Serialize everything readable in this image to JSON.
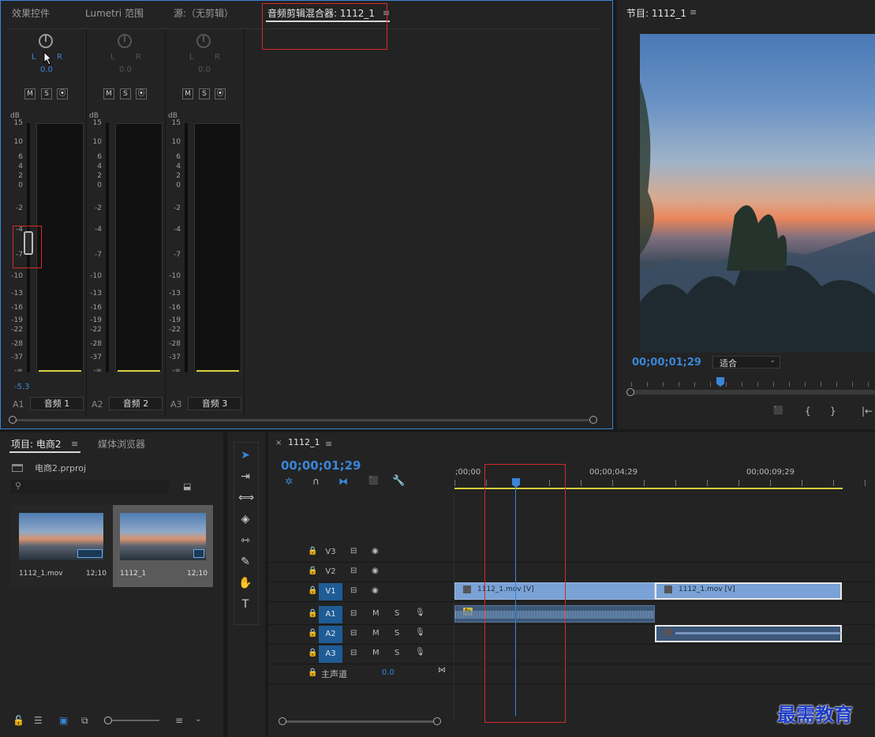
{
  "mixer_panel": {
    "tabs": [
      "效果控件",
      "Lumetri 范围",
      "源:（无剪辑）",
      "音频剪辑混合器: 1112_1"
    ],
    "active_tab_index": 3,
    "db_unit": "dB",
    "scale": [
      "15",
      "10",
      "6",
      "4",
      "2",
      "0",
      "-2",
      "-4",
      "-7",
      "-10",
      "-13",
      "-16",
      "-19",
      "-22",
      "-28",
      "-37",
      "-∞"
    ],
    "channels": [
      {
        "id": "A1",
        "name": "音频 1",
        "pan_l": "L",
        "pan_r": "R",
        "pan_value": "0.0",
        "level": "-5.3",
        "active": true
      },
      {
        "id": "A2",
        "name": "音频 2",
        "pan_l": "L",
        "pan_r": "R",
        "pan_value": "0.0",
        "level": "",
        "active": false
      },
      {
        "id": "A3",
        "name": "音频 3",
        "pan_l": "L",
        "pan_r": "R",
        "pan_value": "0.0",
        "level": "",
        "active": false
      }
    ],
    "msr": [
      "M",
      "S",
      "⦿"
    ]
  },
  "program_monitor": {
    "title": "节目: 1112_1",
    "timecode": "00;00;01;29",
    "fit_option": "适合",
    "controls": [
      "⬛",
      "{",
      "}",
      "|←"
    ]
  },
  "project_panel": {
    "tabs": [
      "项目: 电商2",
      "媒体浏览器"
    ],
    "project_file": "电商2.prproj",
    "items": [
      {
        "name": "1112_1.mov",
        "duration": "12;10"
      },
      {
        "name": "1112_1",
        "duration": "12;10"
      }
    ]
  },
  "timeline": {
    "sequence_tab": "1112_1",
    "timecode": "00;00;01;29",
    "ruler": [
      ";00;00",
      "00;00;04;29",
      "00;00;09;29"
    ],
    "video_tracks": [
      "V3",
      "V2",
      "V1"
    ],
    "audio_tracks": [
      "A1",
      "A2",
      "A3"
    ],
    "master_label": "主声道",
    "master_value": "0.0",
    "clips": {
      "v1_a": "1112_1.mov [V]",
      "v1_b": "1112_1.mov [V]"
    },
    "fx_badge": "fx",
    "track_m": "M",
    "track_s": "S"
  },
  "watermark": "最需教育",
  "colors": {
    "accent": "#3a86d8",
    "target": "#1f5c95",
    "clip_video": "#7aa2d6",
    "clip_audio": "#3c5778",
    "highlight": "#d42a2a",
    "meter_floor": "#d6cf3d"
  }
}
